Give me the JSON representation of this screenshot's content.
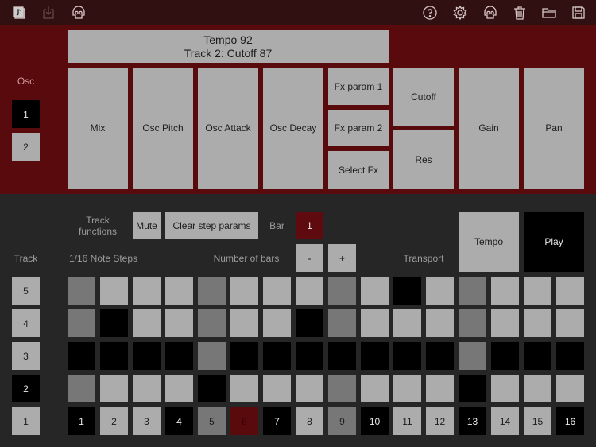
{
  "toolbar": {
    "left_icons": [
      {
        "name": "song-file-icon"
      },
      {
        "name": "import-icon"
      },
      {
        "name": "skull-icon"
      }
    ],
    "right_icons": [
      {
        "name": "help-icon"
      },
      {
        "name": "settings-gear-icon"
      },
      {
        "name": "skull-icon"
      },
      {
        "name": "trash-icon"
      },
      {
        "name": "folder-icon"
      },
      {
        "name": "save-floppy-icon"
      }
    ]
  },
  "display": {
    "line1": "Tempo 92",
    "line2": "Track 2: Cutoff 87"
  },
  "osc": {
    "label": "Osc",
    "buttons": [
      {
        "label": "1",
        "selected": true
      },
      {
        "label": "2",
        "selected": false
      }
    ]
  },
  "params": {
    "mix": "Mix",
    "osc_pitch": "Osc Pitch",
    "osc_attack": "Osc Attack",
    "osc_decay": "Osc Decay",
    "fx_param_1": "Fx param 1",
    "fx_param_2": "Fx param 2",
    "select_fx": "Select Fx",
    "cutoff": "Cutoff",
    "res": "Res",
    "gain": "Gain",
    "pan": "Pan"
  },
  "controls": {
    "track_functions_label": "Track functions",
    "mute": "Mute",
    "clear_step_params": "Clear step params",
    "bar_label": "Bar",
    "bar_value": "1",
    "track_label": "Track",
    "steps_label": "1/16 Note Steps",
    "number_of_bars_label": "Number of bars",
    "minus": "-",
    "plus": "+",
    "transport_label": "Transport",
    "tempo": "Tempo",
    "play": "Play"
  },
  "tracks": [
    {
      "label": "5",
      "selected": false
    },
    {
      "label": "4",
      "selected": false
    },
    {
      "label": "3",
      "selected": false
    },
    {
      "label": "2",
      "selected": true
    },
    {
      "label": "1",
      "selected": false
    }
  ],
  "grid": {
    "legend": {
      "on": "#acacac",
      "accent": "#777777",
      "off": "#000000",
      "current": "#580a0d"
    },
    "rows": [
      {
        "track": "5",
        "steps": [
          "acc",
          "on",
          "on",
          "on",
          "acc",
          "on",
          "on",
          "on",
          "acc",
          "on",
          "off",
          "on",
          "acc",
          "on",
          "on",
          "on"
        ]
      },
      {
        "track": "4",
        "steps": [
          "acc",
          "off",
          "on",
          "on",
          "acc",
          "on",
          "on",
          "off",
          "acc",
          "on",
          "on",
          "on",
          "acc",
          "on",
          "on",
          "on"
        ]
      },
      {
        "track": "3",
        "steps": [
          "off",
          "off",
          "off",
          "off",
          "acc",
          "off",
          "off",
          "off",
          "off",
          "off",
          "off",
          "off",
          "acc",
          "off",
          "off",
          "off"
        ]
      },
      {
        "track": "2",
        "steps": [
          "acc",
          "on",
          "on",
          "on",
          "off",
          "on",
          "on",
          "on",
          "acc",
          "on",
          "on",
          "on",
          "off",
          "on",
          "on",
          "on"
        ]
      }
    ],
    "step_buttons": [
      {
        "label": "1",
        "state": "off"
      },
      {
        "label": "2",
        "state": "on"
      },
      {
        "label": "3",
        "state": "on"
      },
      {
        "label": "4",
        "state": "off"
      },
      {
        "label": "5",
        "state": "acc"
      },
      {
        "label": "6",
        "state": "cur"
      },
      {
        "label": "7",
        "state": "off"
      },
      {
        "label": "8",
        "state": "on"
      },
      {
        "label": "9",
        "state": "acc"
      },
      {
        "label": "10",
        "state": "off"
      },
      {
        "label": "11",
        "state": "on"
      },
      {
        "label": "12",
        "state": "on"
      },
      {
        "label": "13",
        "state": "off"
      },
      {
        "label": "14",
        "state": "on"
      },
      {
        "label": "15",
        "state": "on"
      },
      {
        "label": "16",
        "state": "off"
      }
    ]
  }
}
